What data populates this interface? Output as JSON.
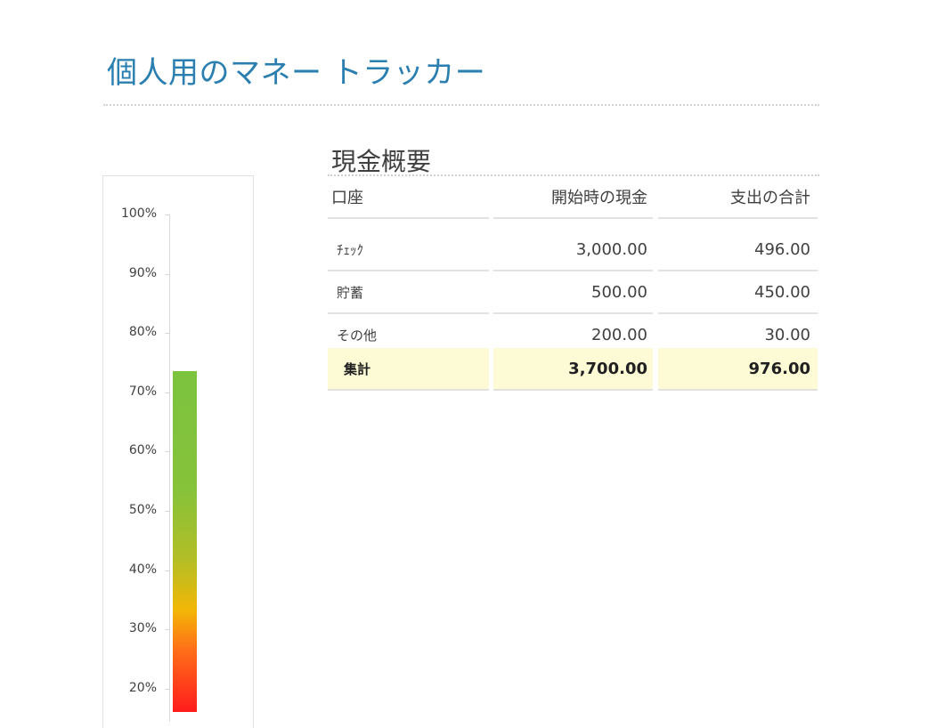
{
  "title": "個人用のマネー トラッカー",
  "gauge": {
    "ticks": [
      "100%",
      "90%",
      "80%",
      "70%",
      "60%",
      "50%",
      "40%",
      "30%",
      "20%"
    ],
    "value_percent": 73.6,
    "colors": {
      "top": "#7cc33e",
      "mid": "#f2b707",
      "bottom": "#ff1c1c"
    }
  },
  "summary": {
    "title": "現金概要",
    "headers": [
      "口座",
      "開始時の現金",
      "支出の合計"
    ],
    "rows": [
      {
        "account": "ﾁｪｯｸ",
        "start": "3,000.00",
        "spent": "496.00"
      },
      {
        "account": "貯蓄",
        "start": "500.00",
        "spent": "450.00"
      },
      {
        "account": "その他",
        "start": "200.00",
        "spent": "30.00"
      }
    ],
    "total": {
      "label": "集計",
      "start": "3,700.00",
      "spent": "976.00"
    },
    "total_bg": "#fdfbd6"
  },
  "accent_color": "#2a7fb0"
}
